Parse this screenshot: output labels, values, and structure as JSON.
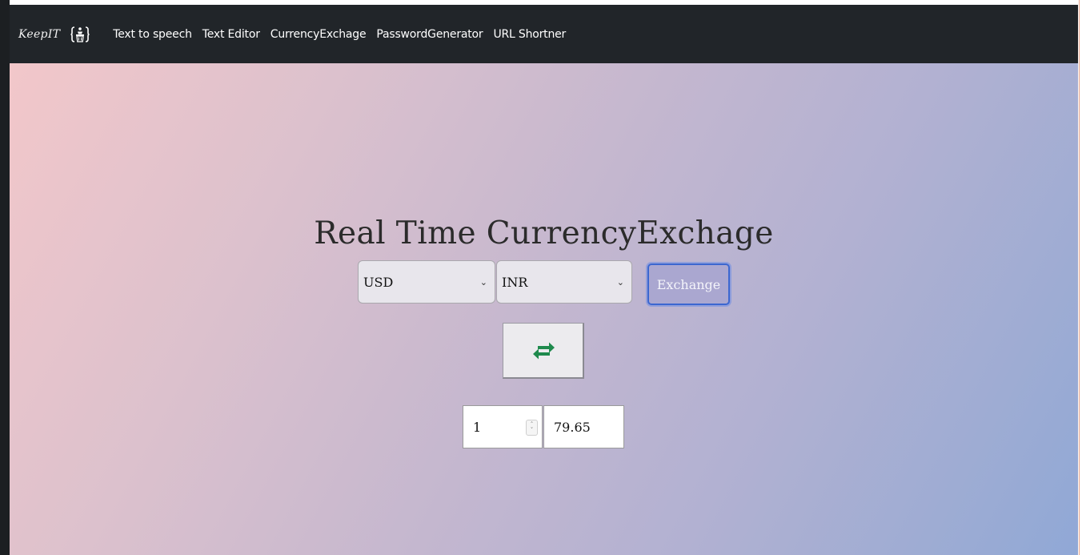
{
  "navbar": {
    "brand": "KeepIT",
    "brand_icon": "person-bin-icon",
    "links": [
      {
        "label": "Text to speech"
      },
      {
        "label": "Text Editor"
      },
      {
        "label": "CurrencyExchage"
      },
      {
        "label": "PasswordGenerator"
      },
      {
        "label": "URL Shortner"
      }
    ]
  },
  "main": {
    "title": "Real Time CurrencyExchage",
    "from_currency": "USD",
    "to_currency": "INR",
    "exchange_label": "Exchange",
    "swap_icon": "swap-arrows-icon",
    "amount": "1",
    "result": "79.65"
  },
  "colors": {
    "navbar_bg": "#212529",
    "swap_icon": "#1f8a4d",
    "exchange_focus": "#3c67d0",
    "gradient_start": "#f2c7ca",
    "gradient_end": "#90a8d6"
  }
}
